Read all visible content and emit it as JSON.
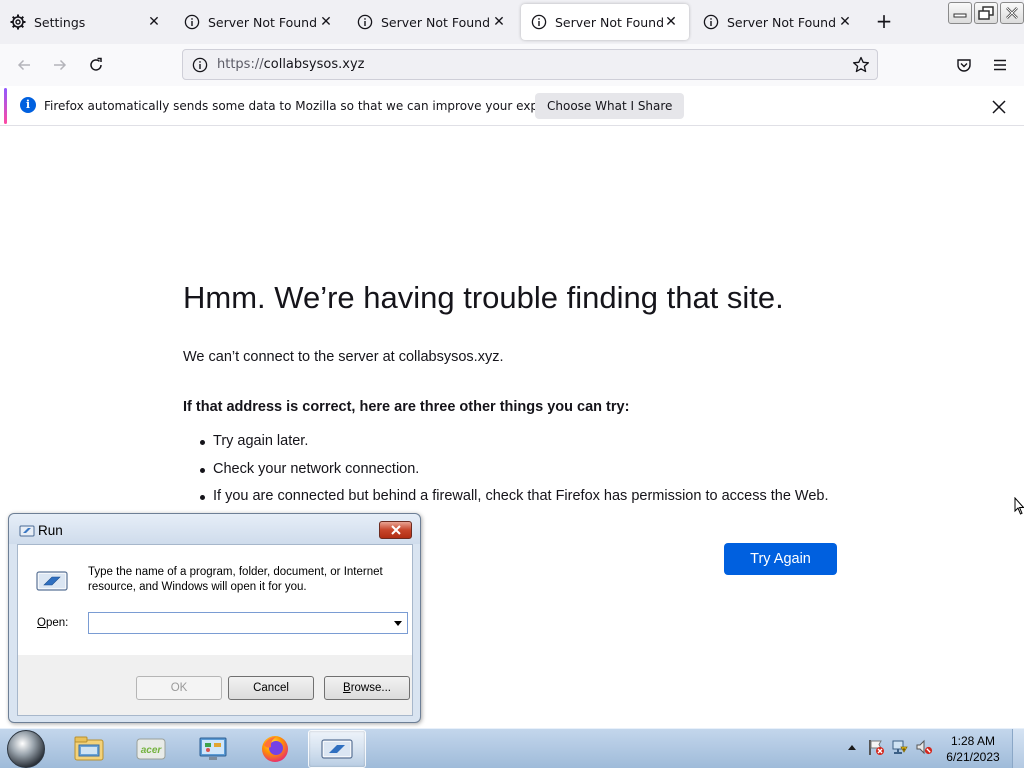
{
  "browser": {
    "tabs": [
      {
        "label": "Settings",
        "icon": "gear-icon",
        "selected": false
      },
      {
        "label": "Server Not Found",
        "icon": "info-icon",
        "selected": false
      },
      {
        "label": "Server Not Found",
        "icon": "info-icon",
        "selected": false
      },
      {
        "label": "Server Not Found",
        "icon": "info-icon",
        "selected": true
      },
      {
        "label": "Server Not Found",
        "icon": "info-icon",
        "selected": false
      }
    ],
    "url_scheme": "https://",
    "url_host": "collabsysos.xyz",
    "notification": {
      "text": "Firefox automatically sends some data to Mozilla so that we can improve your experience.",
      "button_label": "Choose What I Share"
    },
    "accent_color": "#0060df"
  },
  "error_page": {
    "title": "Hmm. We’re having trouble finding that site.",
    "description": "We can’t connect to the server at collabsysos.xyz.",
    "hint_heading": "If that address is correct, here are three other things you can try:",
    "suggestions": [
      "Try again later.",
      "Check your network connection.",
      "If you are connected but behind a firewall, check that Firefox has permission to access the Web."
    ],
    "try_again_label": "Try Again"
  },
  "run_dialog": {
    "title": "Run",
    "description": "Type the name of a program, folder, document, or Internet resource, and Windows will open it for you.",
    "open_label_accel": "O",
    "open_label_rest": "pen:",
    "open_value": "",
    "ok_label": "OK",
    "cancel_label": "Cancel",
    "browse_label_accel": "B",
    "browse_label_rest": "rowse..."
  },
  "taskbar": {
    "items": [
      "explorer-icon",
      "acer-icon",
      "control-panel-icon",
      "firefox-icon",
      "run-icon"
    ],
    "active_item": "run-icon",
    "clock_time": "1:28 AM",
    "clock_date": "6/21/2023"
  }
}
